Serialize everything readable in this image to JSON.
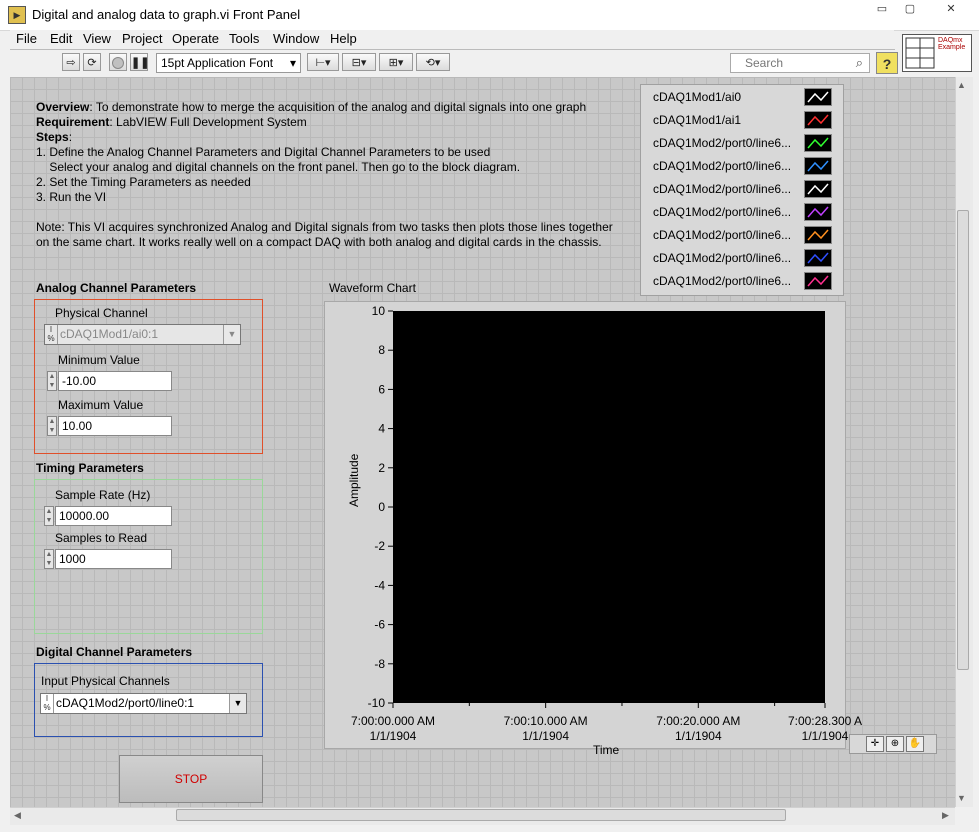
{
  "window": {
    "title": "Digital and analog data to graph.vi Front Panel",
    "min_glyph": "▭",
    "max_glyph": "▢",
    "close_glyph": "✕"
  },
  "menu": [
    "File",
    "Edit",
    "View",
    "Project",
    "Operate",
    "Tools",
    "Window",
    "Help"
  ],
  "toolbar": {
    "font": "15pt Application Font",
    "search_placeholder": "Search",
    "help_glyph": "?",
    "example_icon_text": "DAQmx Example"
  },
  "description": {
    "overview_label": "Overview",
    "overview_text": ": To demonstrate how to merge the acquisition of the analog and digital signals into one graph",
    "requirement_label": "Requirement",
    "requirement_text": ": LabVIEW Full Development System",
    "steps_label": "Steps",
    "steps_colon": ":",
    "steps": [
      "1. Define the Analog Channel Parameters and Digital Channel Parameters to be used",
      "    Select your analog and digital channels on the front panel. Then go to the block diagram.",
      "2. Set the Timing Parameters as needed",
      "3. Run the VI"
    ],
    "note_lines": [
      "Note: This VI acquires synchronized Analog and Digital signals from two tasks then plots those lines together",
      "on the same chart. It works really well on a compact DAQ with both analog and digital cards in the chassis."
    ]
  },
  "analog": {
    "heading": "Analog Channel Parameters",
    "physical_channel_label": "Physical Channel",
    "physical_channel_value": "cDAQ1Mod1/ai0:1",
    "min_label": "Minimum Value",
    "min_value": "-10.00",
    "max_label": "Maximum Value",
    "max_value": "10.00",
    "border_color": "#e0502a"
  },
  "timing": {
    "heading": "Timing Parameters",
    "rate_label": "Sample Rate (Hz)",
    "rate_value": "10000.00",
    "samples_label": "Samples to Read",
    "samples_value": "1000",
    "border_color": "#9ad89a"
  },
  "digital": {
    "heading": "Digital Channel Parameters",
    "channels_label": "Input Physical Channels",
    "channels_value": "cDAQ1Mod2/port0/line0:1",
    "border_color": "#2a50b0"
  },
  "legend": [
    {
      "name": "cDAQ1Mod1/ai0",
      "color": "#ffffff"
    },
    {
      "name": "cDAQ1Mod1/ai1",
      "color": "#ff3030"
    },
    {
      "name": "cDAQ1Mod2/port0/line6...",
      "color": "#30ff30"
    },
    {
      "name": "cDAQ1Mod2/port0/line6...",
      "color": "#3090ff"
    },
    {
      "name": "cDAQ1Mod2/port0/line6...",
      "color": "#ffffff"
    },
    {
      "name": "cDAQ1Mod2/port0/line6...",
      "color": "#c040ff"
    },
    {
      "name": "cDAQ1Mod2/port0/line6...",
      "color": "#ff9020"
    },
    {
      "name": "cDAQ1Mod2/port0/line6...",
      "color": "#3050ff"
    },
    {
      "name": "cDAQ1Mod2/port0/line6...",
      "color": "#ff3090"
    }
  ],
  "stop_button": "STOP",
  "chart_data": {
    "type": "line",
    "title": "Waveform Chart",
    "xlabel": "Time",
    "ylabel": "Amplitude",
    "ylim": [
      -10,
      10
    ],
    "y_ticks": [
      10,
      8,
      6,
      4,
      2,
      0,
      -2,
      -4,
      -6,
      -8,
      -10
    ],
    "x_ticks": [
      {
        "value": 0,
        "time": "7:00:00.000 AM",
        "date": "1/1/1904"
      },
      {
        "value": 10,
        "time": "7:00:10.000 AM",
        "date": "1/1/1904"
      },
      {
        "value": 20,
        "time": "7:00:20.000 AM",
        "date": "1/1/1904"
      },
      {
        "value": 28.3,
        "time": "7:00:28.300 A",
        "date": "1/1/1904"
      }
    ],
    "xlim": [
      0,
      28.3
    ],
    "plot_background": "#000000",
    "series": []
  }
}
